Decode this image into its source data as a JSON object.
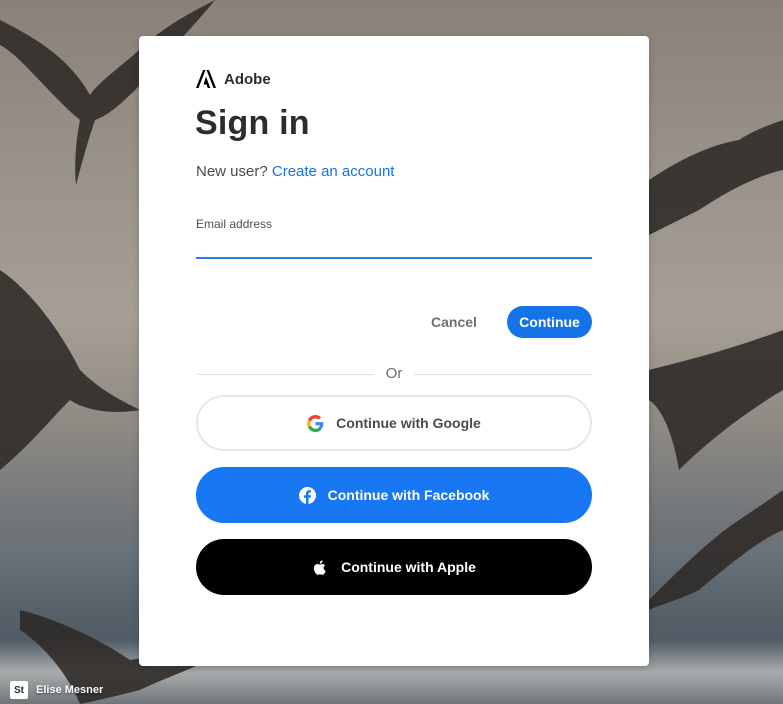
{
  "brand": {
    "name": "Adobe",
    "logo_icon": "adobe-logo-icon",
    "color": "#000000"
  },
  "signin": {
    "title": "Sign in",
    "new_user_text": "New user?",
    "create_account_link": "Create an account",
    "link_color": "#1473e6"
  },
  "email_field": {
    "label": "Email address",
    "value": "",
    "focus_color": "#2680eb"
  },
  "actions": {
    "cancel_label": "Cancel",
    "continue_label": "Continue",
    "continue_color": "#1473e6"
  },
  "divider": {
    "label": "Or"
  },
  "social_buttons": [
    {
      "label": "Continue with Google",
      "icon": "google-icon",
      "background": "#ffffff"
    },
    {
      "label": "Continue with Facebook",
      "icon": "facebook-icon",
      "background": "#1877f2"
    },
    {
      "label": "Continue with Apple",
      "icon": "apple-icon",
      "background": "#000000"
    }
  ],
  "photo_credit": {
    "badge": "St",
    "name": "Elise Mesner"
  }
}
